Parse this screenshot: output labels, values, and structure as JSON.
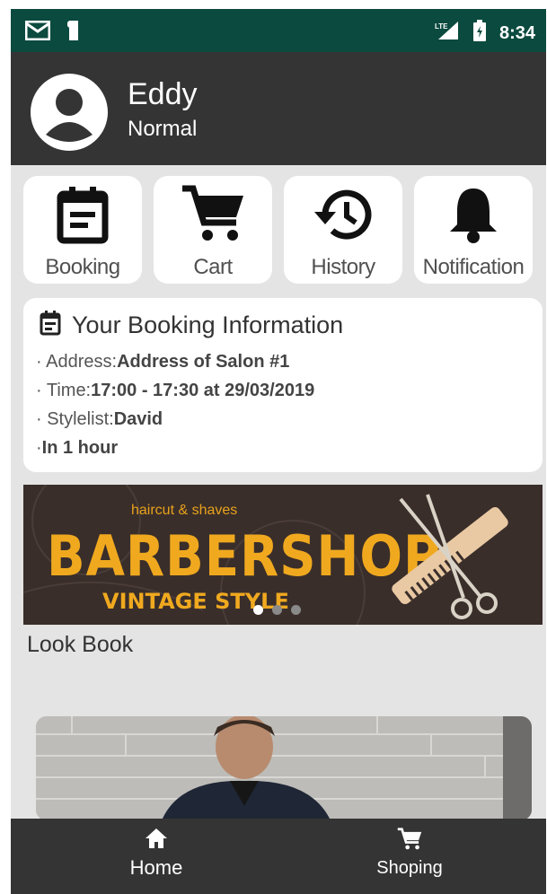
{
  "status_bar": {
    "time": "8:34",
    "icons": [
      "mail-icon",
      "sd-card-icon",
      "lte-signal-icon",
      "battery-icon"
    ]
  },
  "profile": {
    "name": "Eddy",
    "level": "Normal",
    "avatar_icon": "account-circle-icon"
  },
  "menu": [
    {
      "label": "Booking",
      "icon": "calendar-icon"
    },
    {
      "label": "Cart",
      "icon": "cart-icon"
    },
    {
      "label": "History",
      "icon": "history-icon"
    },
    {
      "label": "Notification",
      "icon": "bell-icon"
    }
  ],
  "booking_info": {
    "title": "Your Booking Information",
    "address_label": "Address:",
    "address_value": "Address of Salon #1",
    "time_label": "Time:",
    "time_value": "17:00 - 17:30 at 29/03/2019",
    "stylist_label": "Stylelist:",
    "stylist_value": "David",
    "eta": "In 1 hour"
  },
  "banner": {
    "subtitle": "haircut & shaves",
    "title": "BARBERSHOP",
    "tagline": "VINTAGE STYLE",
    "slide_count": 3,
    "active_slide": 1
  },
  "lookbook": {
    "label": "Look Book"
  },
  "bottom_nav": [
    {
      "label": "Home",
      "icon": "home-icon"
    },
    {
      "label": "Shoping",
      "icon": "cart-icon"
    }
  ],
  "colors": {
    "status_bar": "#0b4a3f",
    "header": "#343434",
    "background": "#e4e4e4",
    "banner_accent": "#f0a91f"
  }
}
